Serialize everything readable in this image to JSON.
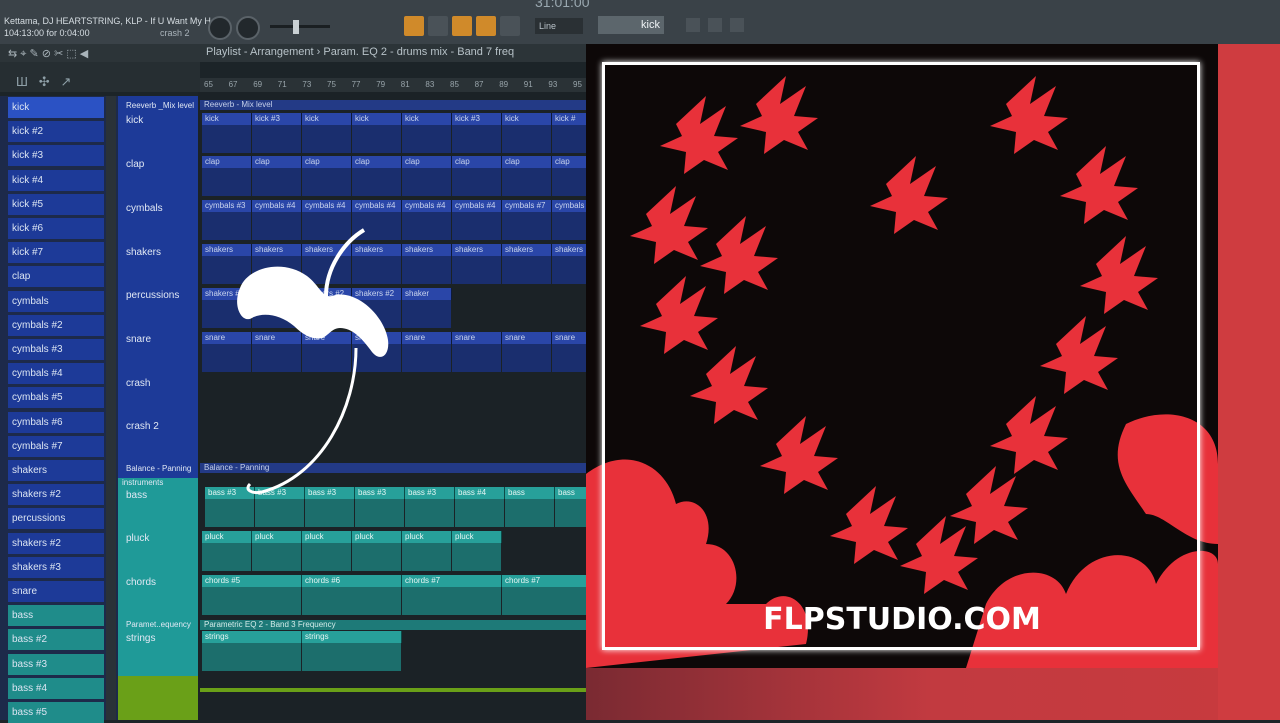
{
  "toolbar": {
    "song_title": "Kettama, DJ HEARTSTRING, KLP - If U Want My He",
    "position": "104:13:00 for 0:04:00",
    "channel": "crash 2",
    "tempo": "31:01:00",
    "line_mode": "Line",
    "pattern_name": "kick"
  },
  "playlist": {
    "breadcrumb": "Playlist - Arrangement  ›  Param. EQ 2 - drums mix - Band 7 freq",
    "ruler": [
      "65",
      "67",
      "69",
      "71",
      "73",
      "75",
      "77",
      "79",
      "81",
      "83",
      "85",
      "87",
      "89",
      "91",
      "93",
      "95"
    ]
  },
  "channels": [
    {
      "label": "kick",
      "color": "sel"
    },
    {
      "label": "kick #2",
      "color": "blue"
    },
    {
      "label": "kick #3",
      "color": "blue"
    },
    {
      "label": "kick #4",
      "color": "blue"
    },
    {
      "label": "kick #5",
      "color": "blue"
    },
    {
      "label": "kick #6",
      "color": "blue"
    },
    {
      "label": "kick #7",
      "color": "blue"
    },
    {
      "label": "clap",
      "color": "blue"
    },
    {
      "label": "cymbals",
      "color": "blue"
    },
    {
      "label": "cymbals #2",
      "color": "blue"
    },
    {
      "label": "cymbals #3",
      "color": "blue"
    },
    {
      "label": "cymbals #4",
      "color": "blue"
    },
    {
      "label": "cymbals #5",
      "color": "blue"
    },
    {
      "label": "cymbals #6",
      "color": "blue"
    },
    {
      "label": "cymbals #7",
      "color": "blue"
    },
    {
      "label": "shakers",
      "color": "blue"
    },
    {
      "label": "shakers #2",
      "color": "blue"
    },
    {
      "label": "percussions",
      "color": "blue"
    },
    {
      "label": "shakers #2",
      "color": "blue"
    },
    {
      "label": "shakers #3",
      "color": "blue"
    },
    {
      "label": "snare",
      "color": "blue"
    },
    {
      "label": "bass",
      "color": "teal"
    },
    {
      "label": "bass #2",
      "color": "teal"
    },
    {
      "label": "bass #3",
      "color": "teal"
    },
    {
      "label": "bass #4",
      "color": "teal"
    },
    {
      "label": "bass #5",
      "color": "teal"
    }
  ],
  "tracks": {
    "reverb": "Reeverb _Mix level",
    "reverb_clip": "Reeverb - Mix level",
    "kick": "kick",
    "clap": "clap",
    "cymbals": "cymbals",
    "shakers": "shakers",
    "percussions": "percussions",
    "snare": "snare",
    "crash": "crash",
    "crash2": "crash 2",
    "balance": "Balance - Panning",
    "balance_clip": "Balance - Panning",
    "instruments": "instruments",
    "bass": "bass",
    "pluck": "pluck",
    "chords": "chords",
    "param": "Paramet..equency",
    "param_clip": "Parametric EQ 2 - Band 3 Frequency",
    "strings": "strings"
  },
  "clips": {
    "kick": [
      "kick",
      "kick #3",
      "kick",
      "kick",
      "kick",
      "kick #3",
      "kick",
      "kick #"
    ],
    "clap": [
      "clap",
      "clap",
      "clap",
      "clap",
      "clap",
      "clap",
      "clap",
      "clap"
    ],
    "cymbals": [
      "cymbals #3",
      "cymbals #4",
      "cymbals #4",
      "cymbals #4",
      "cymbals #4",
      "cymbals #4",
      "cymbals #7",
      "cymbals"
    ],
    "shakers": [
      "shakers",
      "shakers",
      "shakers",
      "shakers",
      "shakers",
      "shakers",
      "shakers",
      "shakers"
    ],
    "percussions": [
      "shakers #2",
      "shakers #2",
      "shakers #2",
      "shakers #2",
      "shaker"
    ],
    "snare": [
      "snare",
      "snare",
      "snare",
      "snare",
      "snare",
      "snare",
      "snare",
      "snare"
    ],
    "bass": [
      "bass #3",
      "bass #3",
      "bass #3",
      "bass #3",
      "bass #3",
      "bass #4",
      "bass",
      "bass"
    ],
    "pluck": [
      "pluck",
      "pluck",
      "pluck",
      "pluck",
      "pluck",
      "pluck"
    ],
    "chords": [
      "chords #5",
      "chords #6",
      "chords #7",
      "chords #7"
    ],
    "strings": [
      "strings",
      "strings"
    ]
  },
  "cover": {
    "site": "FLPSTUDIO.COM",
    "accent": "#e8313a"
  }
}
